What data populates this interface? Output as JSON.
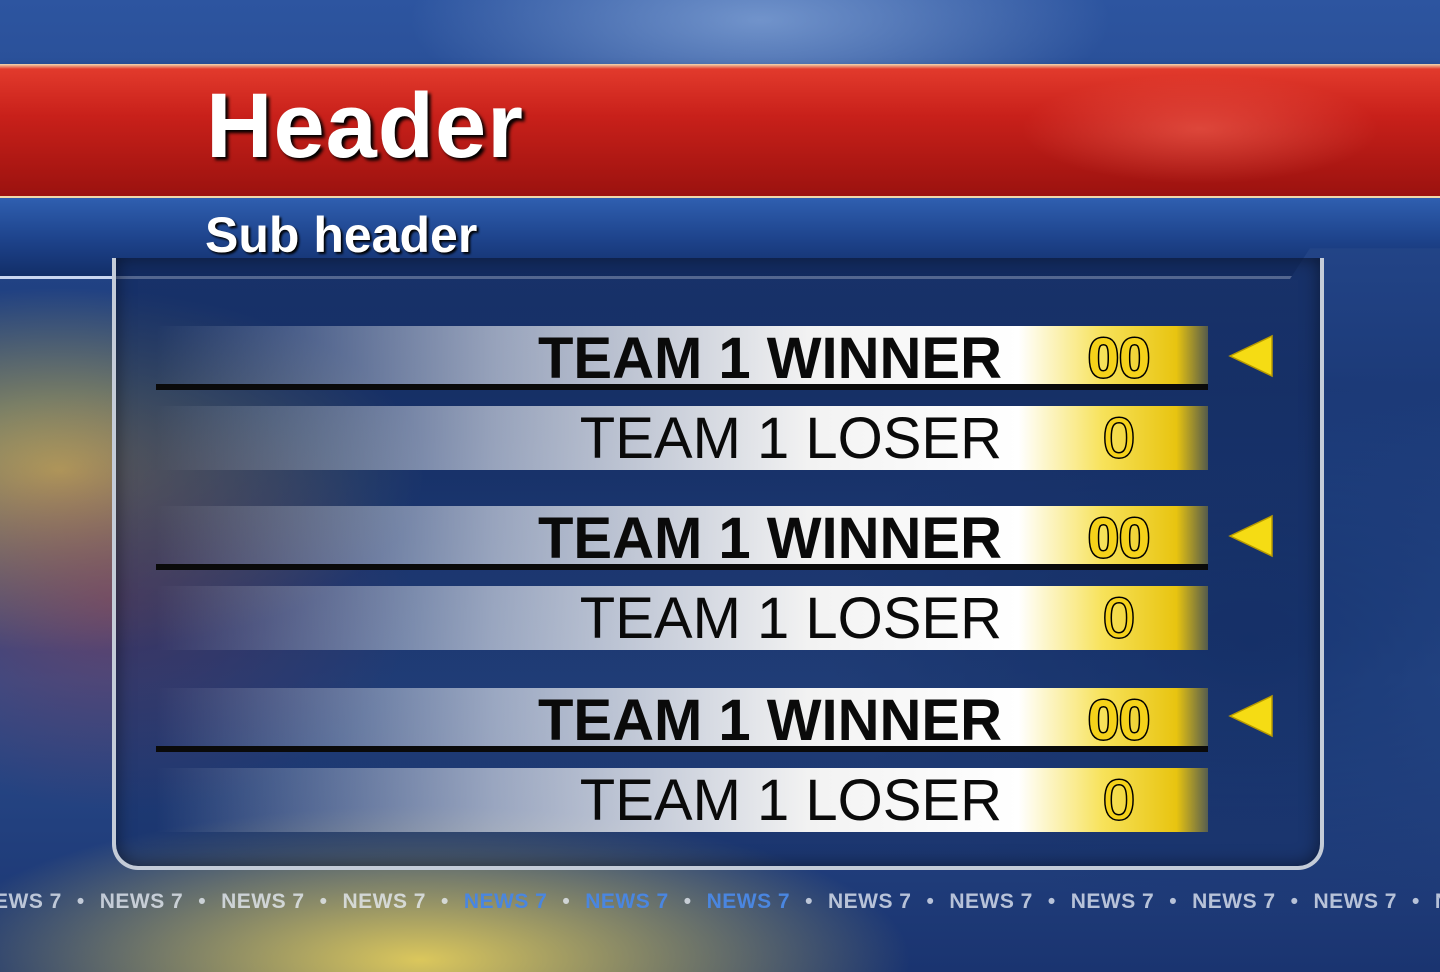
{
  "header": {
    "title": "Header",
    "subtitle": "Sub header"
  },
  "colors": {
    "header_red": "#c8201a",
    "score_yellow": "#f5d21a",
    "panel_border": "#c4ccd8",
    "arrow_yellow": "#f5dc14"
  },
  "games": [
    {
      "winner": {
        "name": "TEAM 1 WINNER",
        "score": "00"
      },
      "loser": {
        "name": "TEAM 1 LOSER",
        "score": "0"
      },
      "indicator_icon": "left-triangle-icon"
    },
    {
      "winner": {
        "name": "TEAM 1 WINNER",
        "score": "00"
      },
      "loser": {
        "name": "TEAM 1 LOSER",
        "score": "0"
      },
      "indicator_icon": "left-triangle-icon"
    },
    {
      "winner": {
        "name": "TEAM 1 WINNER",
        "score": "00"
      },
      "loser": {
        "name": "TEAM 1 LOSER",
        "score": "0"
      },
      "indicator_icon": "left-triangle-icon"
    }
  ],
  "ticker": {
    "separator": "•",
    "items": [
      "EWS 7",
      "NEWS 7",
      "NEWS 7",
      "NEWS 7",
      "NEWS 7",
      "NEWS 7",
      "NEWS 7",
      "NEWS 7",
      "NEWS 7",
      "NEWS 7",
      "NEWS 7",
      "NEWS 7",
      "NEWS"
    ]
  }
}
